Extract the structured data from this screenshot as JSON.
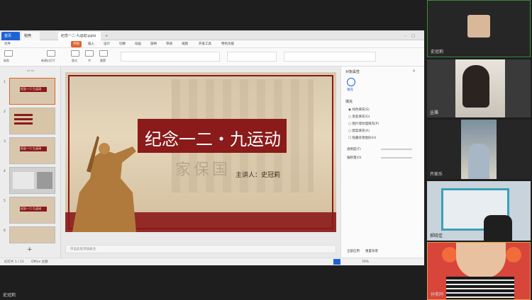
{
  "tabs": {
    "home": "首页",
    "docer": "稻壳",
    "file": "纪念一二·九运动.pptx"
  },
  "menu": [
    "文件",
    "开始",
    "插入",
    "设计",
    "切换",
    "动画",
    "放映",
    "审阅",
    "视图",
    "开发工具",
    "特色功能"
  ],
  "toolbar": {
    "paste": "粘贴",
    "new_slide": "新建幻灯片",
    "layout": "版式",
    "section": "节",
    "reset": "重置"
  },
  "thumbs": [
    {
      "num": "1",
      "title": "纪念一二·九运动",
      "selected": true
    },
    {
      "num": "2",
      "title": "",
      "selected": false
    },
    {
      "num": "3",
      "title": "纪念一二·九运动",
      "selected": false
    },
    {
      "num": "4",
      "title": "",
      "selected": false
    },
    {
      "num": "5",
      "title": "纪念一二·九运动",
      "selected": false
    },
    {
      "num": "6",
      "title": "",
      "selected": false
    }
  ],
  "slide": {
    "title": "纪念一二・九运动",
    "speaker": "主讲人：史冠莉",
    "banner_text": "家保国"
  },
  "notes_placeholder": "单击此处添加备注",
  "status": {
    "slide_pos": "幻灯片 1 / 11",
    "theme": "Office 主题",
    "zoom": "70%"
  },
  "right_panel": {
    "title": "对象属性",
    "tab": "填充",
    "section": "填充",
    "options": [
      "纯色填充(S)",
      "渐变填充(G)",
      "图片或纹理填充(P)",
      "图案填充(A)",
      "隐藏背景图形(H)"
    ],
    "transparency": "透明度(T)",
    "offset": "偏移量(O)",
    "apply_all": "全部应用",
    "reset_bg": "重置背景"
  },
  "participants": [
    {
      "name": "史冠莉",
      "kind": "avatar"
    },
    {
      "name": "丛雅",
      "kind": "video"
    },
    {
      "name": "齐家乐",
      "kind": "video"
    },
    {
      "name": "郝晓佳",
      "kind": "video"
    },
    {
      "name": "孙奕同",
      "kind": "video"
    }
  ],
  "bottom_name": "史冠莉",
  "colors": {
    "accent": "#e0632c",
    "slide_red": "#8b1a1a",
    "panel_bg": "#262626"
  }
}
